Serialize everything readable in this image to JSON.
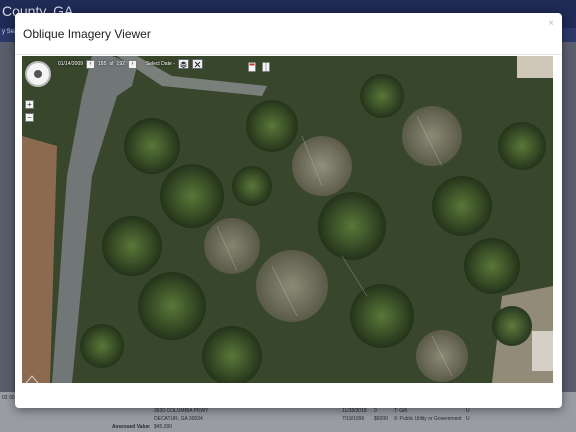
{
  "background": {
    "site_title": "County, GA",
    "strip_text": "y Sear",
    "footer": {
      "side_text": "02 00",
      "address_line1": "3630 COLUMBIA PKWY",
      "address_line2": "DECATUR, GA 30034",
      "assessed_label": "Assessed Value",
      "assessed_value": "$45,000",
      "sales": [
        {
          "date": "11/28/2018",
          "price": "0",
          "type": "T: Gift",
          "code": "U"
        },
        {
          "date": "7/19/1996",
          "price": "$6000",
          "type": "9: Public Utility or Government",
          "code": "U"
        }
      ]
    }
  },
  "modal": {
    "title": "Oblique Imagery Viewer",
    "close_label": "×"
  },
  "viewer": {
    "date": "01/14/2009",
    "image_index": "185",
    "image_total": "192",
    "counter_sep": "of",
    "prev_label": "‹",
    "next_label": "›",
    "select_date_label": "Select Date -",
    "zoom_in_label": "+",
    "zoom_out_label": "−",
    "icons": [
      "layers-icon",
      "tools-icon",
      "print-icon",
      "panel-icon",
      "compass-icon",
      "watermark-icon"
    ]
  }
}
